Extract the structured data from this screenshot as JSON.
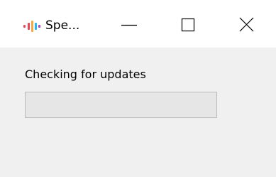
{
  "window": {
    "title": "Spe...",
    "icon": "equalizer-bars-icon",
    "icon_colors": [
      "#e64a5a",
      "#f7a940",
      "#29b6f6",
      "#ab47bc"
    ],
    "controls": {
      "minimize": "minimize-icon",
      "maximize": "maximize-icon",
      "close": "close-icon"
    }
  },
  "main": {
    "status_text": "Checking for updates",
    "progress": {
      "value": 0,
      "track_color": "#e6e6e6",
      "border_color": "#bcbcbc"
    }
  }
}
